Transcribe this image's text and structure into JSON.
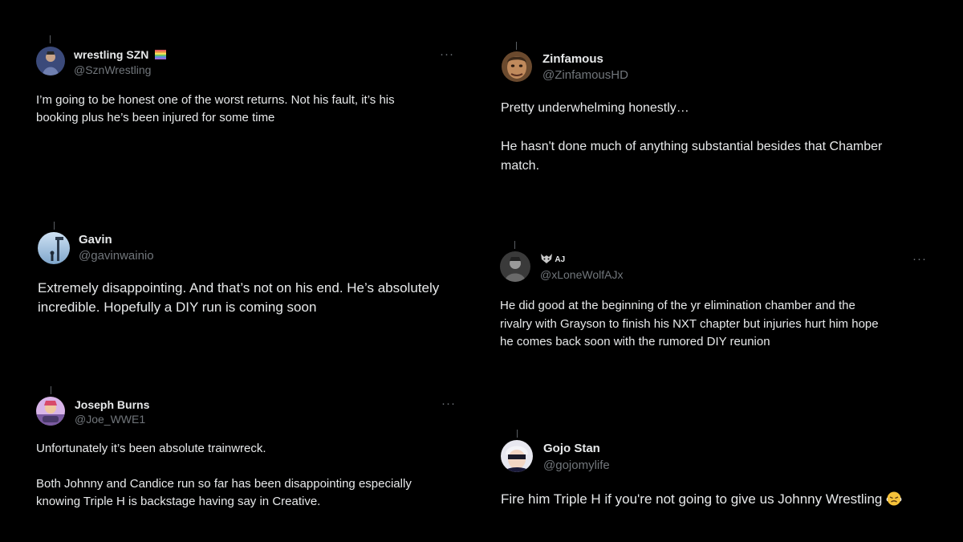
{
  "posts": [
    {
      "name": "wrestling SZN",
      "handle": "@SznWrestling",
      "text": "I’m going to be honest one of the worst returns. Not his fault, it’s his\nbooking plus he’s been injured for some time",
      "more_label": "···",
      "avatar_icon": "wrestler-avatar"
    },
    {
      "name": "Zinfamous",
      "handle": "@ZinfamousHD",
      "text": "Pretty underwhelming honestly…\n\nHe hasn't done much of anything substantial besides that Chamber\nmatch.",
      "avatar_icon": "face-avatar"
    },
    {
      "name": "Gavin",
      "handle": "@gavinwainio",
      "text": "Extremely disappointing. And that’s not on his end. He’s absolutely\nincredible. Hopefully a DIY run is coming soon",
      "avatar_icon": "sky-avatar"
    },
    {
      "name": "AJ",
      "handle": "@xLoneWolfAJx",
      "text": "He did good at the beginning of the yr elimination chamber and the\nrivalry with Grayson to finish his NXT chapter but injuries hurt him hope\nhe comes back soon with the rumored DIY reunion",
      "more_label": "···",
      "avatar_icon": "gray-avatar"
    },
    {
      "name": "Joseph Burns",
      "handle": "@Joe_WWE1",
      "text": "Unfortunately it’s been absolute trainwreck.\n\nBoth Johnny and Candice run so far has been disappointing especially\nknowing Triple H is backstage having say in Creative.",
      "more_label": "···",
      "avatar_icon": "cartoon-avatar"
    },
    {
      "name": "Gojo Stan",
      "handle": "@gojomylife",
      "text": "Fire him Triple H if you're not going to give us Johnny Wrestling",
      "avatar_icon": "anime-avatar",
      "trailing_emoji": "steaming-face-emoji"
    }
  ],
  "colors": {
    "background": "#000000",
    "text": "#e7e9ea",
    "secondary": "#71767b"
  }
}
